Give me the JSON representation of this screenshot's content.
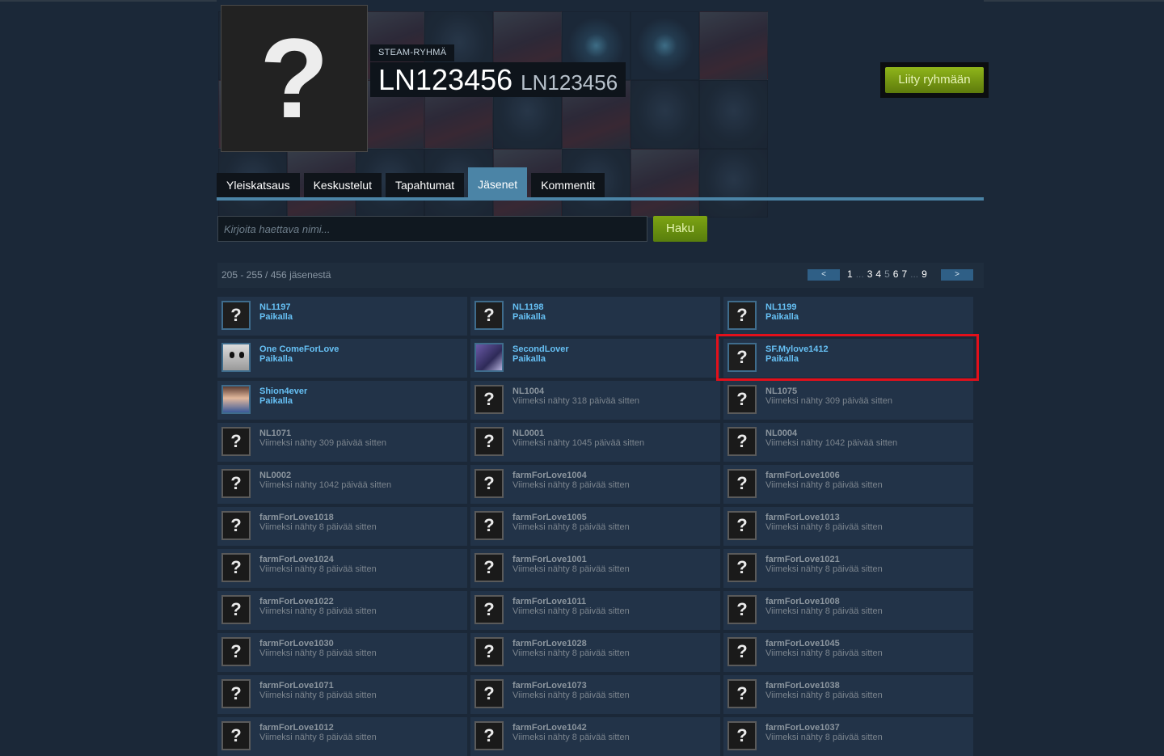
{
  "header": {
    "group_kind": "STEAM-RYHMÄ",
    "group_name": "LN123456",
    "group_tag": "LN123456",
    "avatar_glyph": "?",
    "join_label": "Liity ryhmään"
  },
  "tabs": [
    {
      "label": "Yleiskatsaus",
      "active": false
    },
    {
      "label": "Keskustelut",
      "active": false
    },
    {
      "label": "Tapahtumat",
      "active": false
    },
    {
      "label": "Jäsenet",
      "active": true
    },
    {
      "label": "Kommentit",
      "active": false
    }
  ],
  "search": {
    "placeholder": "Kirjoita haettava nimi...",
    "button_label": "Haku"
  },
  "pager": {
    "count_text": "205 - 255 / 456 jäsenestä",
    "prev_label": "<",
    "next_label": ">",
    "links": [
      "1",
      "...",
      "3",
      "4",
      "5",
      "6",
      "7",
      "...",
      "9"
    ],
    "current_page": "5"
  },
  "members": [
    {
      "name": "NL1197",
      "status": "Paikalla",
      "online": true,
      "avatar": "question"
    },
    {
      "name": "NL1198",
      "status": "Paikalla",
      "online": true,
      "avatar": "question"
    },
    {
      "name": "NL1199",
      "status": "Paikalla",
      "online": true,
      "avatar": "question"
    },
    {
      "name": "One ComeForLove",
      "status": "Paikalla",
      "online": true,
      "avatar": "skull"
    },
    {
      "name": "SecondLover",
      "status": "Paikalla",
      "online": true,
      "avatar": "anime1"
    },
    {
      "name": "SF.Mylove1412",
      "status": "Paikalla",
      "online": true,
      "avatar": "question",
      "highlighted": true
    },
    {
      "name": "Shion4ever",
      "status": "Paikalla",
      "online": true,
      "avatar": "anime2"
    },
    {
      "name": "NL1004",
      "status": "Viimeksi nähty 318 päivää sitten",
      "online": false,
      "avatar": "question"
    },
    {
      "name": "NL1075",
      "status": "Viimeksi nähty 309 päivää sitten",
      "online": false,
      "avatar": "question"
    },
    {
      "name": "NL1071",
      "status": "Viimeksi nähty 309 päivää sitten",
      "online": false,
      "avatar": "question"
    },
    {
      "name": "NL0001",
      "status": "Viimeksi nähty 1045 päivää sitten",
      "online": false,
      "avatar": "question"
    },
    {
      "name": "NL0004",
      "status": "Viimeksi nähty 1042 päivää sitten",
      "online": false,
      "avatar": "question"
    },
    {
      "name": "NL0002",
      "status": "Viimeksi nähty 1042 päivää sitten",
      "online": false,
      "avatar": "question"
    },
    {
      "name": "farmForLove1004",
      "status": "Viimeksi nähty 8 päivää sitten",
      "online": false,
      "avatar": "question"
    },
    {
      "name": "farmForLove1006",
      "status": "Viimeksi nähty 8 päivää sitten",
      "online": false,
      "avatar": "question"
    },
    {
      "name": "farmForLove1018",
      "status": "Viimeksi nähty 8 päivää sitten",
      "online": false,
      "avatar": "question"
    },
    {
      "name": "farmForLove1005",
      "status": "Viimeksi nähty 8 päivää sitten",
      "online": false,
      "avatar": "question"
    },
    {
      "name": "farmForLove1013",
      "status": "Viimeksi nähty 8 päivää sitten",
      "online": false,
      "avatar": "question"
    },
    {
      "name": "farmForLove1024",
      "status": "Viimeksi nähty 8 päivää sitten",
      "online": false,
      "avatar": "question"
    },
    {
      "name": "farmForLove1001",
      "status": "Viimeksi nähty 8 päivää sitten",
      "online": false,
      "avatar": "question"
    },
    {
      "name": "farmForLove1021",
      "status": "Viimeksi nähty 8 päivää sitten",
      "online": false,
      "avatar": "question"
    },
    {
      "name": "farmForLove1022",
      "status": "Viimeksi nähty 8 päivää sitten",
      "online": false,
      "avatar": "question"
    },
    {
      "name": "farmForLove1011",
      "status": "Viimeksi nähty 8 päivää sitten",
      "online": false,
      "avatar": "question"
    },
    {
      "name": "farmForLove1008",
      "status": "Viimeksi nähty 8 päivää sitten",
      "online": false,
      "avatar": "question"
    },
    {
      "name": "farmForLove1030",
      "status": "Viimeksi nähty 8 päivää sitten",
      "online": false,
      "avatar": "question"
    },
    {
      "name": "farmForLove1028",
      "status": "Viimeksi nähty 8 päivää sitten",
      "online": false,
      "avatar": "question"
    },
    {
      "name": "farmForLove1045",
      "status": "Viimeksi nähty 8 päivää sitten",
      "online": false,
      "avatar": "question"
    },
    {
      "name": "farmForLove1071",
      "status": "Viimeksi nähty 8 päivää sitten",
      "online": false,
      "avatar": "question"
    },
    {
      "name": "farmForLove1073",
      "status": "Viimeksi nähty 8 päivää sitten",
      "online": false,
      "avatar": "question"
    },
    {
      "name": "farmForLove1038",
      "status": "Viimeksi nähty 8 päivää sitten",
      "online": false,
      "avatar": "question"
    },
    {
      "name": "farmForLove1012",
      "status": "Viimeksi nähty 8 päivää sitten",
      "online": false,
      "avatar": "question"
    },
    {
      "name": "farmForLove1042",
      "status": "Viimeksi nähty 8 päivää sitten",
      "online": false,
      "avatar": "question"
    },
    {
      "name": "farmForLove1037",
      "status": "Viimeksi nähty 8 päivää sitten",
      "online": false,
      "avatar": "question"
    }
  ],
  "colors": {
    "background": "#1b2838",
    "online_text": "#66c0f4",
    "offline_text": "#8b959e",
    "active_tab": "#4b84a6",
    "join_button": "#8fb51a",
    "highlight": "#e3101b"
  }
}
